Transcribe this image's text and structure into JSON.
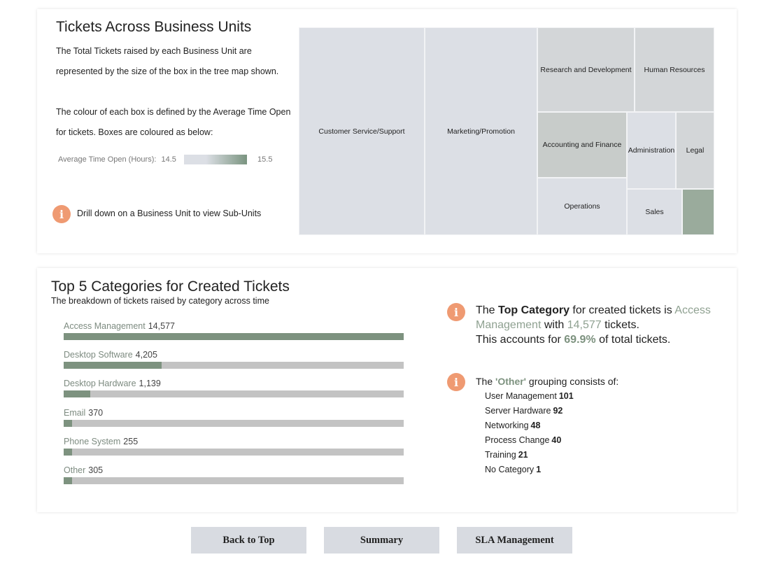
{
  "business_units": {
    "title": "Tickets Across Business Units",
    "desc1": "The Total Tickets raised by each Business Unit are represented by the size of the box in the tree map shown.",
    "desc2": "The colour of each box is defined by the Average Time Open for tickets. Boxes are coloured as below:",
    "legend": {
      "label": "Average Time Open (Hours):",
      "min": "14.5",
      "max": "15.5"
    },
    "drill_text": "Drill down on a Business Unit to view  Sub-Units",
    "treemap": [
      {
        "name": "Customer Service/Support",
        "color": "#dcdfe5"
      },
      {
        "name": "Marketing/Promotion",
        "color": "#dcdfe5"
      },
      {
        "name": "Research and Development",
        "color": "#d3d6d8"
      },
      {
        "name": "Human Resources",
        "color": "#d3d6d8"
      },
      {
        "name": "Accounting and Finance",
        "color": "#c8ccca"
      },
      {
        "name": "Administration",
        "color": "#dcdfe5"
      },
      {
        "name": "Legal",
        "color": "#d3d6d8"
      },
      {
        "name": "Operations",
        "color": "#dcdfe5"
      },
      {
        "name": "Sales",
        "color": "#dcdfe5"
      },
      {
        "name": "",
        "color": "#9aab9c"
      }
    ]
  },
  "top_categories": {
    "title": "Top 5 Categories for Created Tickets",
    "subtitle": "The breakdown of tickets raised by category across time",
    "bars": [
      {
        "label": "Access Management",
        "value_text": "14,577",
        "value": 14577
      },
      {
        "label": "Desktop Software",
        "value_text": "4,205",
        "value": 4205
      },
      {
        "label": "Desktop Hardware",
        "value_text": "1,139",
        "value": 1139
      },
      {
        "label": "Email",
        "value_text": "370",
        "value": 370
      },
      {
        "label": "Phone System",
        "value_text": "255",
        "value": 255
      },
      {
        "label": "Other",
        "value_text": "305",
        "value": 305
      }
    ],
    "max_value": 14577,
    "insight": {
      "the": "The",
      "top_category_label": "Top Category",
      "for_created": "for created tickets is",
      "category": "Access Management",
      "with": "with",
      "count": "14,577",
      "tickets": "tickets.",
      "accounts": "This accounts for",
      "percent": "69.9%",
      "of_total": "of total tickets."
    },
    "other": {
      "head_pre": "The",
      "head_word": "'Other'",
      "head_post": "grouping consists of:",
      "items": [
        {
          "name": "User Management",
          "count": "101"
        },
        {
          "name": "Server Hardware",
          "count": "92"
        },
        {
          "name": "Networking",
          "count": "48"
        },
        {
          "name": "Process Change",
          "count": "40"
        },
        {
          "name": "Training",
          "count": "21"
        },
        {
          "name": "No Category",
          "count": "1"
        }
      ]
    }
  },
  "buttons": {
    "back_to_top": "Back to Top",
    "summary": "Summary",
    "sla": "SLA Management"
  }
}
